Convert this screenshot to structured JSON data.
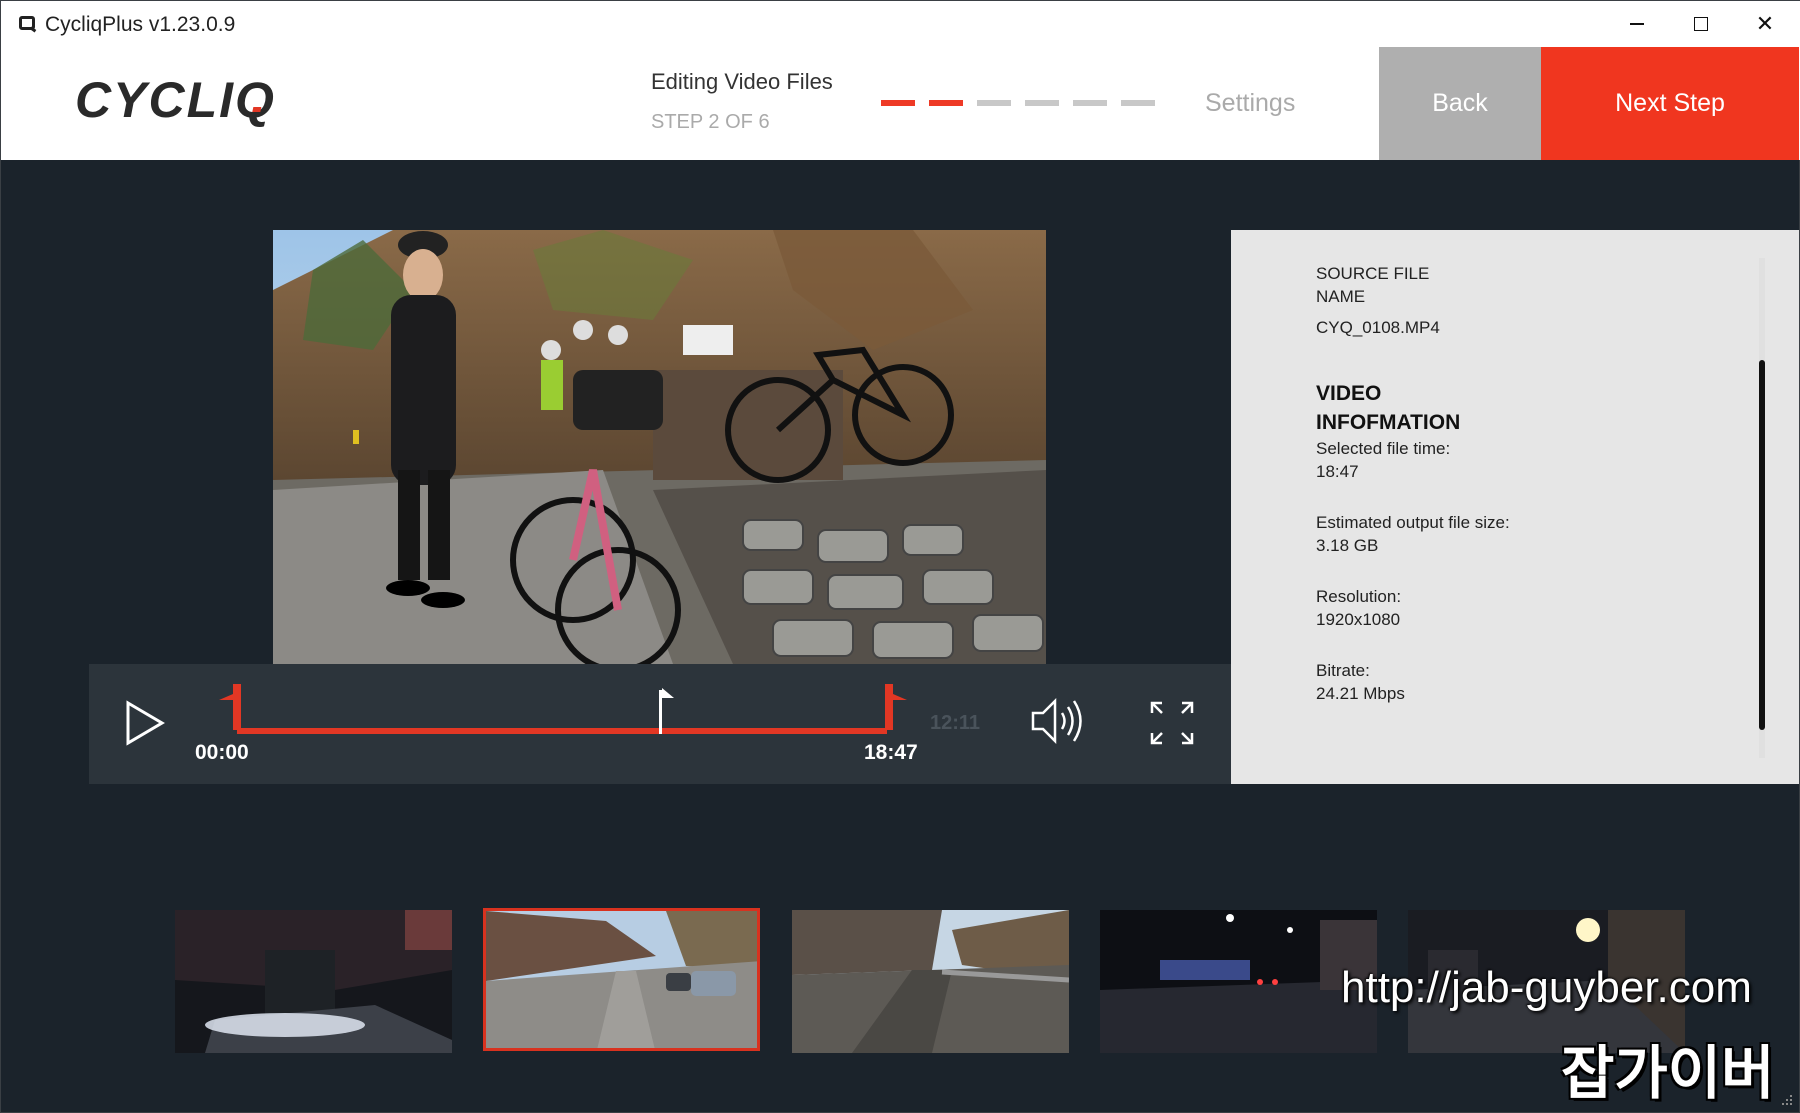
{
  "window": {
    "title": "CycliqPlus v1.23.0.9",
    "minimize_label": "",
    "close_label": "✕"
  },
  "header": {
    "logo_text": "CYCLIQ",
    "step_title": "Editing Video Files",
    "step_subtitle": "STEP 2 OF 6",
    "progress_total": 6,
    "progress_current": 2,
    "next_step_name": "Settings",
    "back_label": "Back",
    "next_label": "Next Step",
    "accent_color": "#f0361f"
  },
  "player": {
    "start_time": "00:00",
    "end_time": "18:47",
    "total_time": "12:11",
    "trim_color": "#e23724"
  },
  "info": {
    "source_label": "SOURCE FILE\nNAME",
    "source_value": "CYQ_0108.MP4",
    "heading": "VIDEO INFOFMATION",
    "selected_time_label": "Selected file time:",
    "selected_time_value": "18:47",
    "output_size_label": "Estimated output file size:",
    "output_size_value": "3.18 GB",
    "resolution_label": "Resolution:",
    "resolution_value": "1920x1080",
    "bitrate_label": "Bitrate:",
    "bitrate_value": "24.21 Mbps"
  },
  "thumbnails": [
    {
      "id": "thumb-1",
      "selected": false
    },
    {
      "id": "thumb-2",
      "selected": true
    },
    {
      "id": "thumb-3",
      "selected": false
    },
    {
      "id": "thumb-4",
      "selected": false
    },
    {
      "id": "thumb-5",
      "selected": false
    }
  ],
  "watermark": {
    "url": "http://jab-guyber.com",
    "korean": "잡가이버"
  }
}
